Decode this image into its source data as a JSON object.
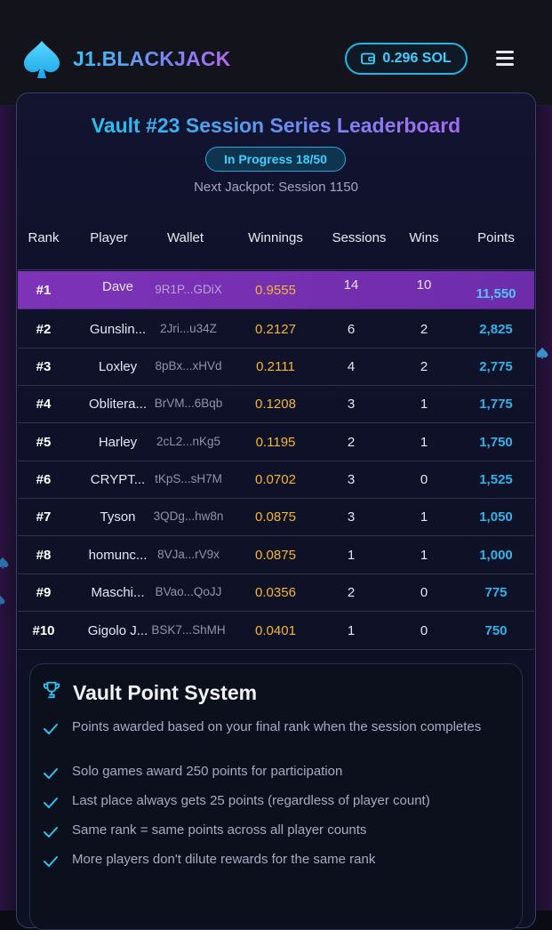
{
  "header": {
    "brand": "J1.BLACKJACK",
    "balance": "0.296 SOL",
    "icons": [
      "spade-logo-icon",
      "wallet-icon",
      "menu-icon"
    ]
  },
  "leaderboard": {
    "title": "Vault #23 Session Series Leaderboard",
    "status": "In Progress 18/50",
    "next_jackpot": "Next Jackpot: Session 1150",
    "columns": [
      "Rank",
      "Player",
      "Wallet",
      "Winnings",
      "Sessions",
      "Wins",
      "Points"
    ],
    "rows": [
      {
        "rank": "#1",
        "player": "Dave",
        "wallet": "9R1P...GDiX",
        "winnings": "0.9555",
        "sessions": "14",
        "wins": "10",
        "points": "11,550"
      },
      {
        "rank": "#2",
        "player": "Gunslin...",
        "wallet": "2Jri...u34Z",
        "winnings": "0.2127",
        "sessions": "6",
        "wins": "2",
        "points": "2,825"
      },
      {
        "rank": "#3",
        "player": "Loxley",
        "wallet": "8pBx...xHVd",
        "winnings": "0.2111",
        "sessions": "4",
        "wins": "2",
        "points": "2,775"
      },
      {
        "rank": "#4",
        "player": "Oblitera...",
        "wallet": "BrVM...6Bqb",
        "winnings": "0.1208",
        "sessions": "3",
        "wins": "1",
        "points": "1,775"
      },
      {
        "rank": "#5",
        "player": "Harley",
        "wallet": "2cL2...nKg5",
        "winnings": "0.1195",
        "sessions": "2",
        "wins": "1",
        "points": "1,750"
      },
      {
        "rank": "#6",
        "player": "CRYPT...",
        "wallet": "tKpS...sH7M",
        "winnings": "0.0702",
        "sessions": "3",
        "wins": "0",
        "points": "1,525"
      },
      {
        "rank": "#7",
        "player": "Tyson",
        "wallet": "3QDg...hw8n",
        "winnings": "0.0875",
        "sessions": "3",
        "wins": "1",
        "points": "1,050"
      },
      {
        "rank": "#8",
        "player": "homunc...",
        "wallet": "8VJa...rV9x",
        "winnings": "0.0875",
        "sessions": "1",
        "wins": "1",
        "points": "1,000"
      },
      {
        "rank": "#9",
        "player": "Maschi...",
        "wallet": "BVao...QoJJ",
        "winnings": "0.0356",
        "sessions": "2",
        "wins": "0",
        "points": "775"
      },
      {
        "rank": "#10",
        "player": "Gigolo J...",
        "wallet": "BSK7...ShMH",
        "winnings": "0.0401",
        "sessions": "1",
        "wins": "0",
        "points": "750"
      }
    ]
  },
  "points_system": {
    "title": "Vault Point System",
    "icon": "trophy-icon",
    "rules": [
      "Points awarded based on your final rank when the session completes",
      "Solo games award 250 points for participation",
      "Last place always gets 25 points (regardless of player count)",
      "Same rank = same points across all player counts",
      "More players don't dilute rewards for the same rank"
    ]
  },
  "colors": {
    "accent_cyan": "#2fb3e8",
    "accent_purple": "#7d33b8",
    "winnings_gold": "#f4b730",
    "background": "#0b0b14"
  }
}
